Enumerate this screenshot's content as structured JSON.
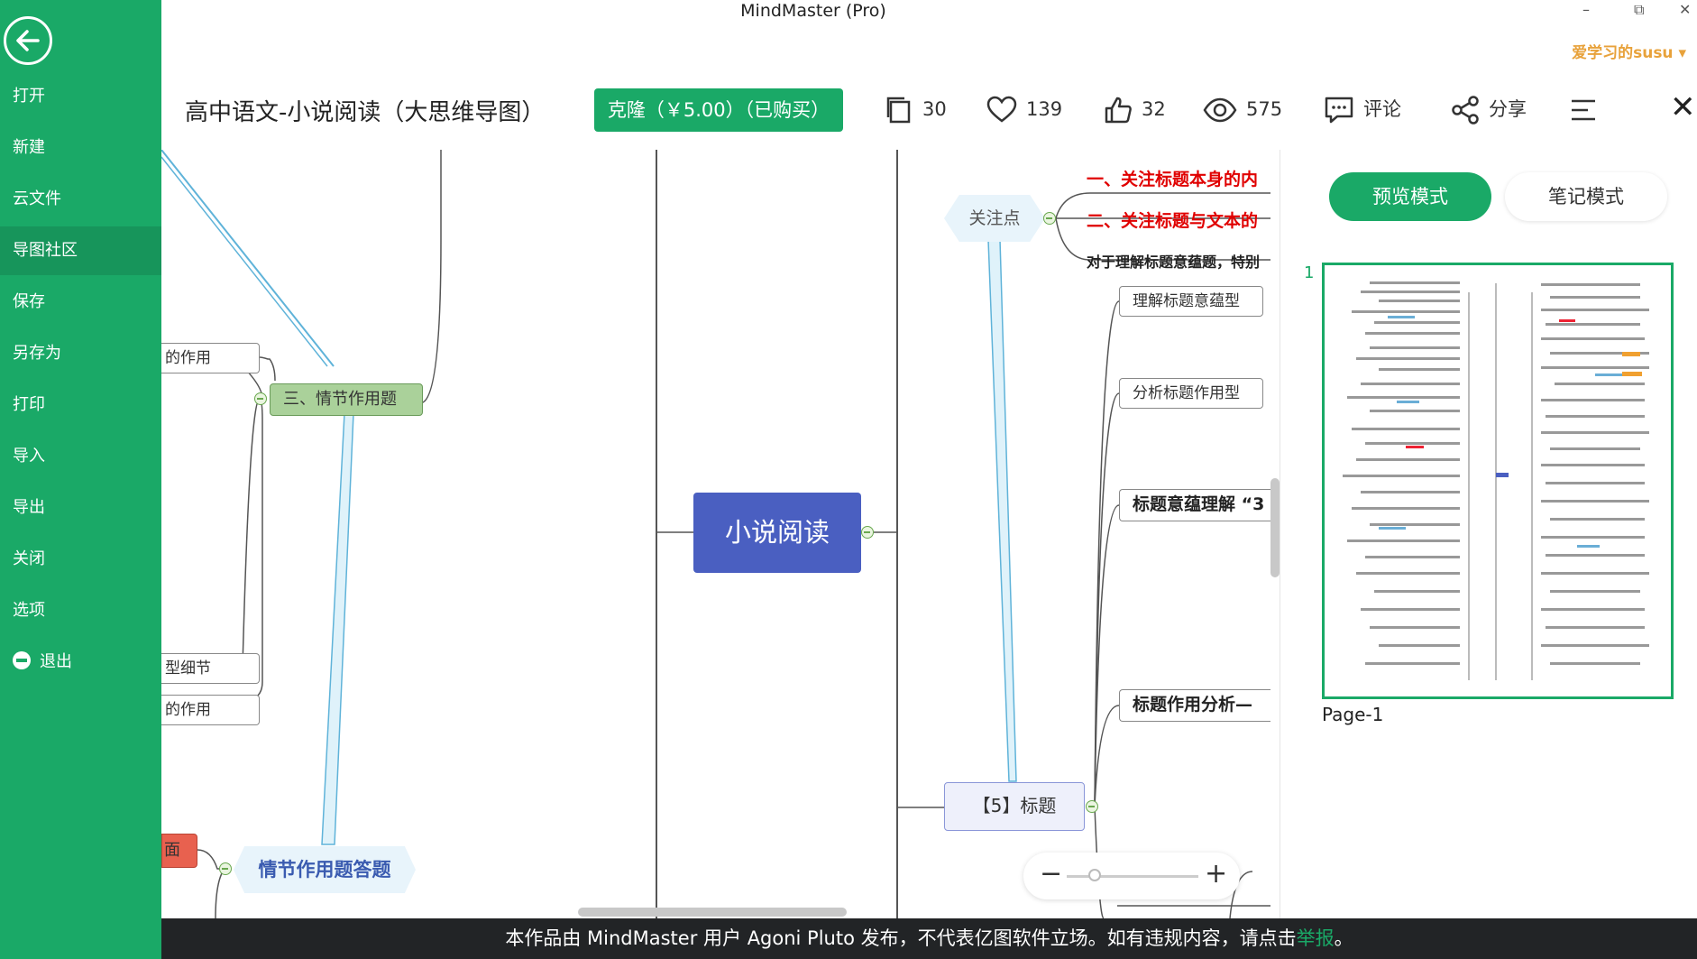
{
  "app": {
    "title": "MindMaster (Pro)",
    "user": "爱学习的susu",
    "controls": [
      "–",
      "⧉",
      "✕"
    ]
  },
  "sidebar": {
    "items": [
      {
        "label": "打开"
      },
      {
        "label": "新建"
      },
      {
        "label": "云文件"
      },
      {
        "label": "导图社区"
      },
      {
        "label": "保存"
      },
      {
        "label": "另存为"
      },
      {
        "label": "打印"
      },
      {
        "label": "导入"
      },
      {
        "label": "导出"
      },
      {
        "label": "关闭"
      },
      {
        "label": "选项"
      },
      {
        "label": "退出"
      }
    ],
    "active_index": 3
  },
  "toolbar": {
    "doc_title": "高中语文-小说阅读（大思维导图）",
    "clone_label": "克隆（￥5.00）（已购买）",
    "pages_count": "30",
    "favorites_count": "139",
    "likes_count": "32",
    "views_count": "575",
    "comment_label": "评论",
    "share_label": "分享"
  },
  "canvas": {
    "central": "小说阅读",
    "nodes": {
      "zuoyong1": "的作用",
      "qingjie3": "三、情节作用题",
      "dianxing": "型细节",
      "zuoyong2": "的作用",
      "mian": "面",
      "qingjie_answer": "情节作用题答题",
      "guanzhu": "关注点",
      "red1": "一、关注标题本身的内",
      "red2": "二、关注标题与文本的",
      "dui": "对于理解标题意蕴题，特别",
      "lijie": "理解标题意蕴型",
      "fenxi": "分析标题作用型",
      "yiyun": "标题意蕴理解 “3",
      "zuoyongfx": "标题作用分析—",
      "biaoti": "【5】标题"
    }
  },
  "right_panel": {
    "preview_label": "预览模式",
    "note_label": "笔记模式",
    "thumb_index": "1",
    "page_label": "Page-1"
  },
  "notice": {
    "text": "本作品由 MindMaster 用户 Agoni Pluto 发布，不代表亿图软件立场。如有违规内容，请点击",
    "link": "举报",
    "end": "。"
  },
  "colors": {
    "accent": "#1aa967",
    "central": "#4a5fc1",
    "notice_bg": "#222426"
  }
}
